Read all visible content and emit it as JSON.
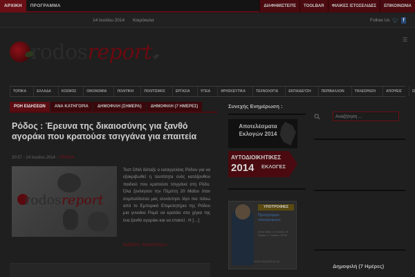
{
  "topbar": {
    "left_items": [
      "ΑΡΧΙΚΗ",
      "ΠΡΟΓΡΑΜΜΑ"
    ],
    "right_items": [
      "ΔΙΑΦΗΜΙΣΤΕΙΤΕ",
      "TOOLBAR",
      "ΦΙΛΙΚΕΣ ΙΣΤΟΣΕΛΙΔΕΣ",
      "ΕΠΙΚΟΙΝΩΝΙΑ"
    ]
  },
  "dateline": {
    "date": "14 Ιουλίου 2014",
    "location": "Καιρόκαλα",
    "follow": "Follow Us"
  },
  "logo": {
    "name_a": "rodos",
    "name_b": "report",
    "tld": ".gr"
  },
  "nav": [
    "ΤΟΠΙΚΑ",
    "ΕΛΛΑΔΑ",
    "ΚΟΣΜΟΣ",
    "ΟΙΚΟΝΟΜΙΑ",
    "ΠΟΛΙΤΙΚΗ",
    "ΠΟΛΙΤΙΣΜΟΣ",
    "ΕΡΓΑΣΙΑ",
    "ΥΓΕΙΑ",
    "ΘΡΗΣΚΕΥΤΙΚΑ",
    "ΤΕΧΝΟΛΟΓΙΑ",
    "ΕΚΠΑΙΔΕΥΣΗ",
    "ΠΕΡΙΒΑΛΛΟΝ",
    "ΤΗΛΕΟΡΑΣΗ",
    "ΑΠΟΨΕΙΣ",
    "ΣΚΑΝΔΑΛΑ"
  ],
  "tabs": [
    "ΡΟΗ ΕΙΔΗΣΕΩΝ",
    "ΑΝΑ ΚΑΤΗΓΟΡΙΑ",
    "ΔΗΜΟΦΙΛΗ (ΣΗΜΕΡΑ)",
    "ΔΗΜΟΦΙΛΗ (7 ΗΜΕΡΕΣ)"
  ],
  "article": {
    "title": "Ρόδος : Έρευνα της δικαιοσύνης για ξανθό αγοράκι που κρατούσε τσιγγάνα για επαιτεία",
    "time": "20:57",
    "date": "14 Ιουλίου 2014",
    "category": "ΤΟΠΙΚΑ",
    "excerpt": "Τεστ DNA διέταξε ο εισαγγελέας Ρόδου για να εξακριβωθεί η ταυτότητα ενός κατάξανθου παιδιού που κρατούσε τσιγγάνα στη Ρόδο. Όλα ξεκίνησαν την Πέμπτη 20 Μαΐου όταν συμπολίτισσα μας συνάντησε λίγο πιο πάνω από το Εμπορικό Επιμελητήριο της Ρόδου μια γυναίκα Ρομά να κρατάει στα χέρια της ένα ξανθό αγοράκι και να επαιτεί . Η […]",
    "read_more": "Διαβάστε περισσότερα »"
  },
  "middle": {
    "title": "Συνεχής Ενημέρωση :",
    "banner1": "Αποτελέσματα Εκλογών 2014",
    "banner2_top": "ΑΥΤΟΔΙΟΙΚΗΤΙΚΕΣ",
    "banner2_year": "2014",
    "banner2_bottom": "ΕΚΛΟΓΕΣ",
    "ad_header": "ΥΠΟΤΡΟΦΙΕΣ",
    "ad_sub": "Πρόγραμμα υποτροφιών",
    "ad_lines": "για τις τάξεις: • Α' Λυκείου • Β' Λυκείου • Γ' Λυκείου • ΕΠΑΛ",
    "ad_web": "www.ekpaideusi.gr"
  },
  "right": {
    "search_placeholder": "Αναζήτηση ...",
    "popular_title": "Δημοφιλή (7 Ημέρες)"
  },
  "colors": {
    "brand": "#6a0f15",
    "background": "#1f1f1f",
    "text": "#cfcfcf"
  },
  "icons": [
    "menu-icon",
    "twitter-icon",
    "facebook-icon",
    "search-icon"
  ]
}
